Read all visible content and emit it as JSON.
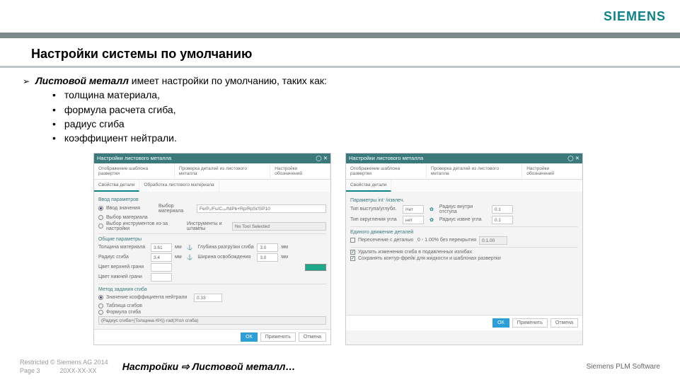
{
  "logo": "SIEMENS",
  "title": "Настройки системы по умолчанию",
  "lead": {
    "bold": "Листовой металл",
    "rest": " имеет настройки по умолчанию, таких как:"
  },
  "bullets": [
    "толщина материала,",
    "формула расчета сгиба,",
    "радиус сгиба",
    "коэффициент нейтрали."
  ],
  "dialog1": {
    "title": "Настройки листового металла",
    "tabs": [
      "Отображение шаблона развертки",
      "Проверка деталей из листового металла",
      "Настройки обозначений"
    ],
    "subtabs": [
      "Свойства детали",
      "Обработка листового материала"
    ],
    "sec_input": "Ввод параметров",
    "opt_properties": "Ввод значения",
    "prop_label": "Выбор материала",
    "prop_val": "Fe/P₂/Fu/C₃₀/NiPb+Rp/RpSr/SP10",
    "opt_mat": "Выбор материала",
    "opt_tooldef": "Выбор инструментов из-за настройки",
    "tool_label": "Инструменты и штампы",
    "tool_val": "No Tool Selected",
    "sec_common": "Общие параметры",
    "thick_label": "Толщина материала",
    "thick_val": "3.61",
    "thick_unit": "мм",
    "rad_label": "Радиус сгиба",
    "rad_val": "3.4",
    "rad_unit": "мм",
    "glub_label": "Глубина разгрузки сгиба",
    "glub_val": "3.0",
    "glub_unit": "мм",
    "shir_label": "Ширина освобождения",
    "shir_val": "3.0",
    "shir_unit": "мм",
    "face_color": "Цвет верхней грани",
    "face_color2": "Цвет нижней грани",
    "sec_bend": "Метод задания сгиба",
    "opt_neutral": "Значение коэффициента нейтрали",
    "neutral_val": "0.33",
    "opt_table": "Таблица сгибов",
    "opt_formula": "Формула сгиба",
    "formula_text": "(Радиус сгиба+(Толщина·КН))·rad(Угол сгиба)",
    "btn_ok": "ОК",
    "btn_apply": "Применить",
    "btn_cancel": "Отмена"
  },
  "dialog2": {
    "title": "Настройки листового металла",
    "tabs": [
      "Отображение шаблона развертки",
      "Проверка деталей из листового металла",
      "Настройки обозначений"
    ],
    "subtab": "Свойства детали",
    "sec_params": "Параметры int⁻/извлеч.",
    "type_label": "Тип выступа/углубл.",
    "type_val": "Нет",
    "ang_label": "Тип округления угла",
    "ang_val": "нет",
    "r1_label": "Радиус внутри отступа",
    "r1v": "0.1",
    "r2v": "0.1",
    "r2_label": "Радиус извне угла",
    "sec_self": "Единого движение деталей",
    "chk_pass": "Пересечение с деталью",
    "lbl_010": "0 - 1.00% без перекрытия",
    "val_010": "0.1.00",
    "chk_del": "Удалять изменения сгиба в подавленных изгибах",
    "chk_save": "Сохранять контур-фрейк для жидкости и шаблонах развертки",
    "btn_ok": "ОК",
    "btn_apply": "Применить",
    "btn_cancel": "Отмена"
  },
  "footer": {
    "restricted": "Restricted © Siemens AG 2014",
    "page": "Page 3",
    "date": "20XX-XX-XX",
    "caption_a": "Настройки ",
    "caption_b": " Листовой металл…",
    "right": "Siemens PLM Software"
  }
}
